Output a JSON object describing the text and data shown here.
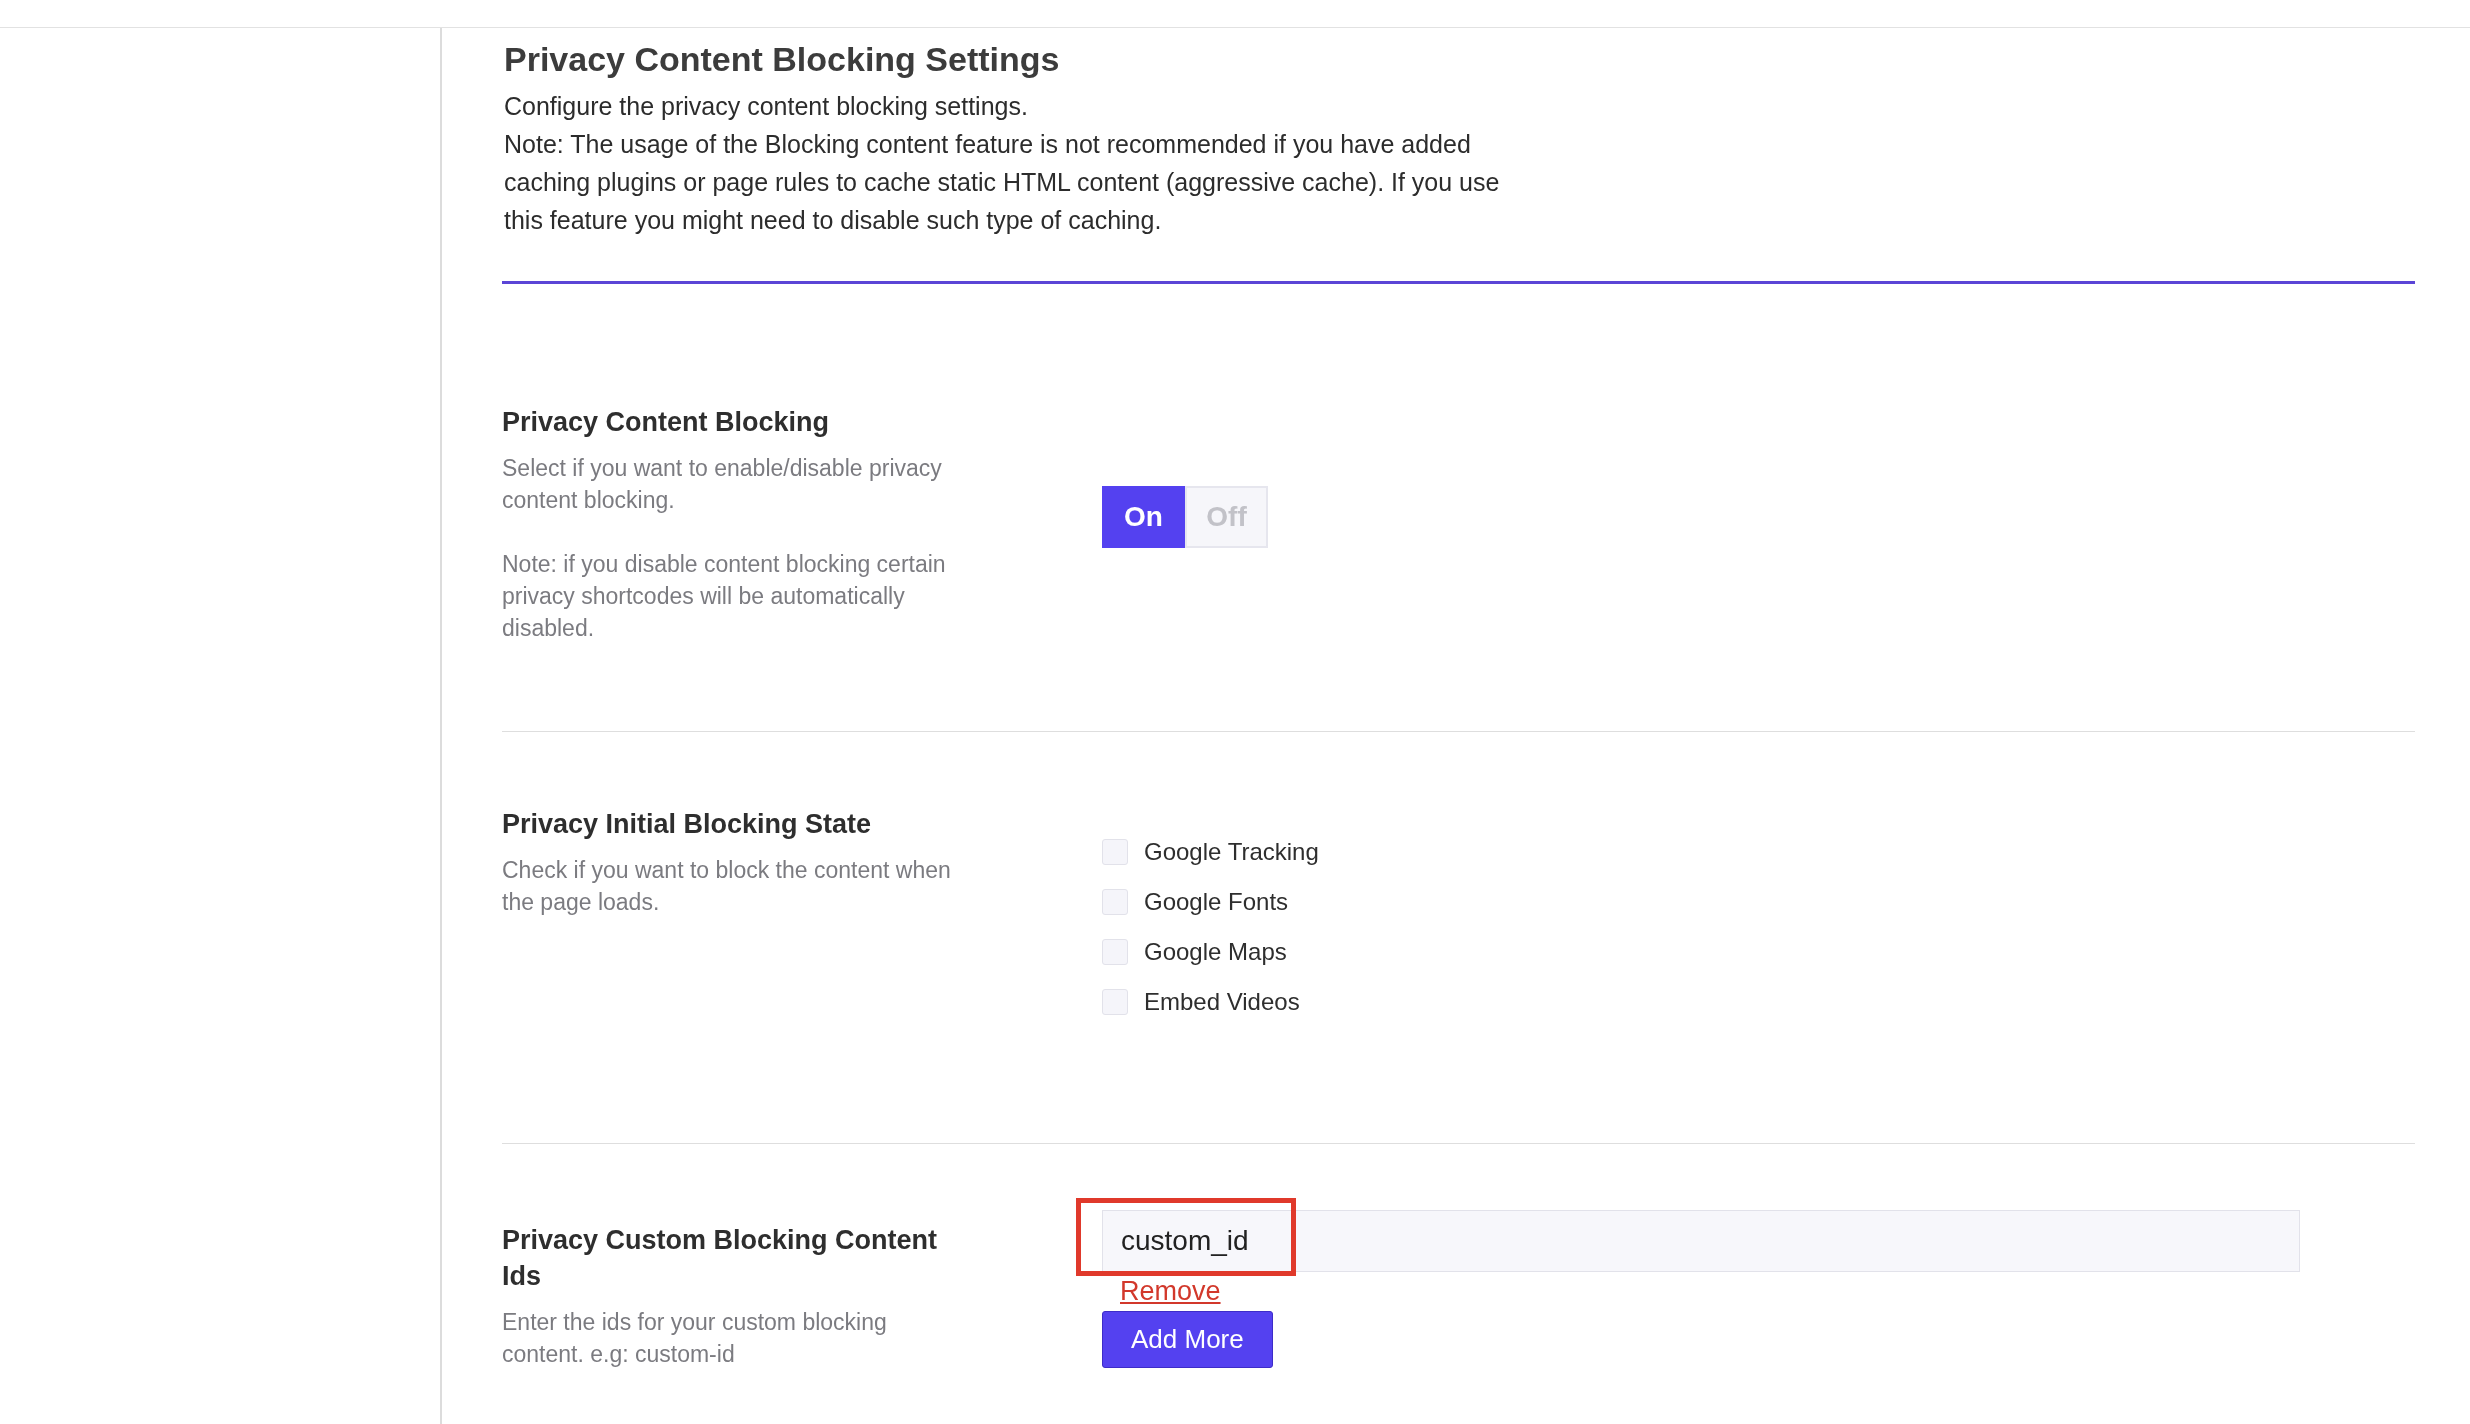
{
  "header": {
    "title": "Privacy Content Blocking Settings",
    "lines": [
      "Configure the privacy content blocking settings.",
      "Note: The usage of the Blocking content feature is not recommended if you have added caching plugins or page rules to cache static HTML content (aggressive cache). If you use this feature you might need to disable such type of caching."
    ]
  },
  "sections": [
    {
      "kind": "toggle",
      "title": "Privacy Content Blocking",
      "descriptions": [
        "Select if you want to enable/disable privacy content blocking.",
        "Note: if you disable content blocking certain privacy shortcodes will be automatically disabled."
      ],
      "options": [
        {
          "label": "On",
          "selected": true
        },
        {
          "label": "Off",
          "selected": false
        }
      ]
    },
    {
      "kind": "checkboxes",
      "title": "Privacy Initial Blocking State",
      "descriptions": [
        "Check if you want to block the content when the page loads."
      ],
      "options": [
        {
          "label": "Google Tracking",
          "checked": false
        },
        {
          "label": "Google Fonts",
          "checked": false
        },
        {
          "label": "Google Maps",
          "checked": false
        },
        {
          "label": "Embed Videos",
          "checked": false
        }
      ]
    },
    {
      "kind": "ids",
      "title": "Privacy Custom Blocking Content Ids",
      "descriptions": [
        "Enter the ids for your custom blocking content. e.g: custom-id"
      ],
      "inputs": [
        {
          "value": "custom_id",
          "highlighted": true,
          "remove_label": "Remove"
        }
      ],
      "add_label": "Add More"
    }
  ]
}
